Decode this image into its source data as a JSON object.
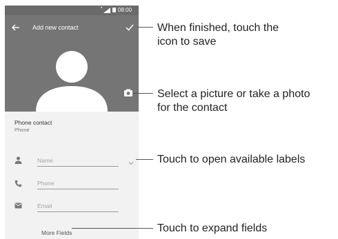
{
  "status_bar": {
    "time": "08:00"
  },
  "toolbar": {
    "title": "Add new contact",
    "back_icon": "back-arrow-icon",
    "save_icon": "checkmark-icon"
  },
  "photo": {
    "avatar_icon": "person-silhouette-icon",
    "camera_icon": "camera-icon"
  },
  "account": {
    "title": "Phone contact",
    "subtitle": "Phone"
  },
  "form": {
    "name": {
      "placeholder": "Name",
      "icon": "person-icon"
    },
    "phone": {
      "placeholder": "Phone",
      "icon": "phone-icon"
    },
    "email": {
      "placeholder": "Email",
      "icon": "email-icon"
    },
    "more_fields": "More Fields"
  },
  "callouts": {
    "save": "When finished, touch the\nicon to save",
    "photo": "Select a picture or take a photo\nfor the contact",
    "labels": "Touch to open available labels",
    "expand": "Touch to expand fields"
  },
  "colors": {
    "toolbar": "#757575",
    "status_bar": "#6a6a6a",
    "form_background": "#f2f2f2",
    "callout_text": "#222222"
  }
}
